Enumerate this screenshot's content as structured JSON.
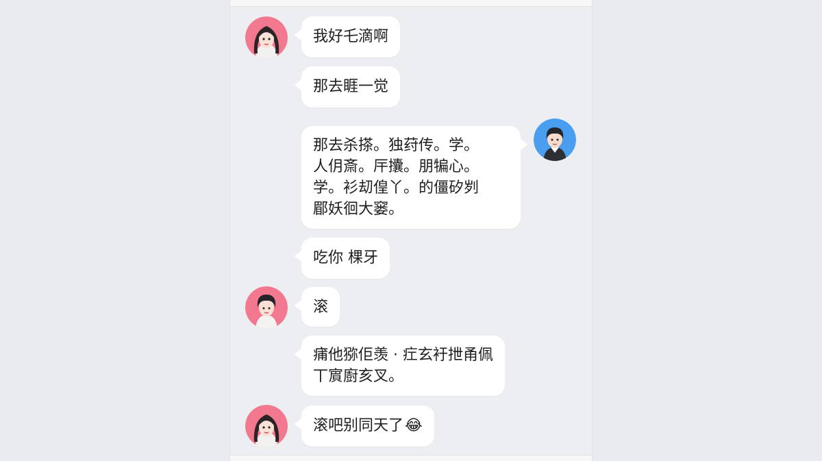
{
  "colors": {
    "page_bg": "#e9ebee",
    "chat_bg": "#edeef1",
    "bubble_bg": "#ffffff",
    "avatar_girl_bg": "#f2788f",
    "avatar_boy_bg": "#4a9ef0"
  },
  "messages": [
    {
      "sender": "girl",
      "side": "left",
      "avatar_icon": "girl-avatar-icon",
      "lines": [
        "我好乇滴啊"
      ]
    },
    {
      "sender": "girl",
      "side": "left",
      "lines": [
        "那去睚一觉"
      ]
    },
    {
      "sender": "boy",
      "side": "right",
      "avatar_icon": "boy-avatar-icon",
      "lines": [
        "那去杀搽。独荮传。学。",
        "人仴斎。厈攮。朋犏心。",
        "学。衫刧偟丫。的僵矽刿",
        "郿妖徊大窭。"
      ]
    },
    {
      "sender": "girl",
      "side": "left",
      "lines": [
        "吃你 棵牙"
      ]
    },
    {
      "sender": "boy",
      "side": "left",
      "avatar_icon": "boy-pink-avatar-icon",
      "lines": [
        "滚"
      ]
    },
    {
      "sender": "boy",
      "side": "left",
      "lines": [
        "痡他猕佢羡 · 疘玄衧抴甬佩",
        "丅賔廚亥叉。"
      ]
    },
    {
      "sender": "girl",
      "side": "left",
      "avatar_icon": "girl-avatar-icon",
      "lines": [
        "滚吧别同天了"
      ],
      "emoji": "😂"
    }
  ]
}
